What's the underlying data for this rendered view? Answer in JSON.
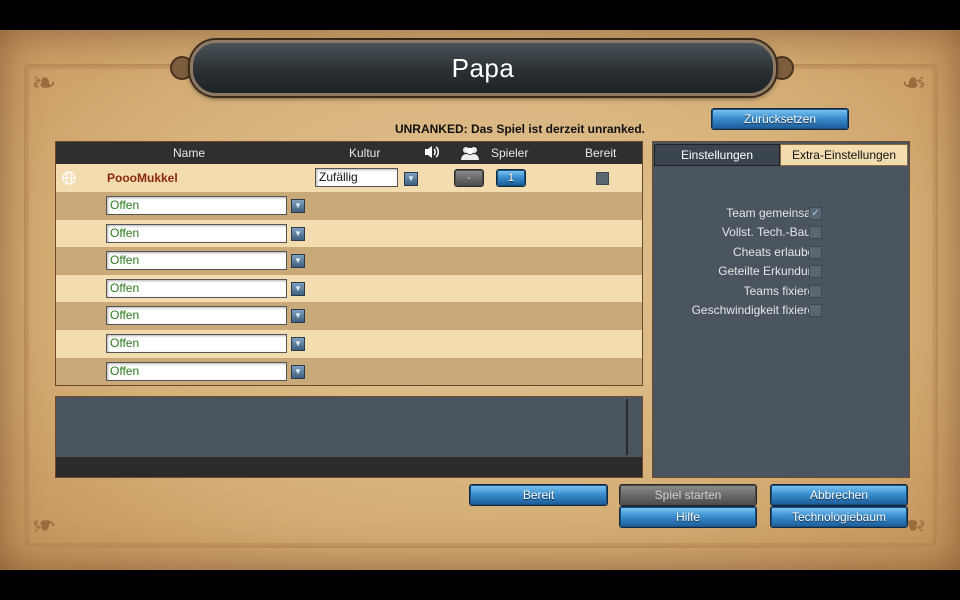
{
  "window": {
    "title": "Papa"
  },
  "reset_button": "Zurücksetzen",
  "status_text": "UNRANKED: Das Spiel ist derzeit unranked.",
  "players_table": {
    "headers": {
      "name": "Name",
      "culture": "Kultur",
      "players": "Spieler",
      "ready": "Bereit"
    },
    "host": {
      "name": "PoooMukkel",
      "culture": "Zufällig",
      "team": "-",
      "player_number": "1",
      "ready": false
    },
    "slots": [
      {
        "value": "Offen"
      },
      {
        "value": "Offen"
      },
      {
        "value": "Offen"
      },
      {
        "value": "Offen"
      },
      {
        "value": "Offen"
      },
      {
        "value": "Offen"
      },
      {
        "value": "Offen"
      }
    ]
  },
  "settings": {
    "tabs": [
      "Einstellungen",
      "Extra-Einstellungen"
    ],
    "active_tab": "Extra-Einstellungen",
    "options": [
      {
        "label": "Team gemeinsam",
        "checked": true
      },
      {
        "label": "Vollst. Tech.-Baum",
        "checked": false
      },
      {
        "label": "Cheats erlauben",
        "checked": false
      },
      {
        "label": "Geteilte Erkundung",
        "checked": false
      },
      {
        "label": "Teams fixieren",
        "checked": false
      },
      {
        "label": "Geschwindigkeit fixieren",
        "checked": false
      }
    ]
  },
  "buttons": {
    "ready": "Bereit",
    "start_game": "Spiel starten",
    "cancel": "Abbrechen",
    "help": "Hilfe",
    "tech_tree": "Technologiebaum"
  },
  "icons": {
    "speaker": "speaker-icon",
    "players": "people-icon",
    "globe": "globe-icon"
  },
  "colors": {
    "accent_blue": "#3a8fd0",
    "open_slot_text": "#2c7a1c",
    "host_name": "#8a2a0a"
  }
}
